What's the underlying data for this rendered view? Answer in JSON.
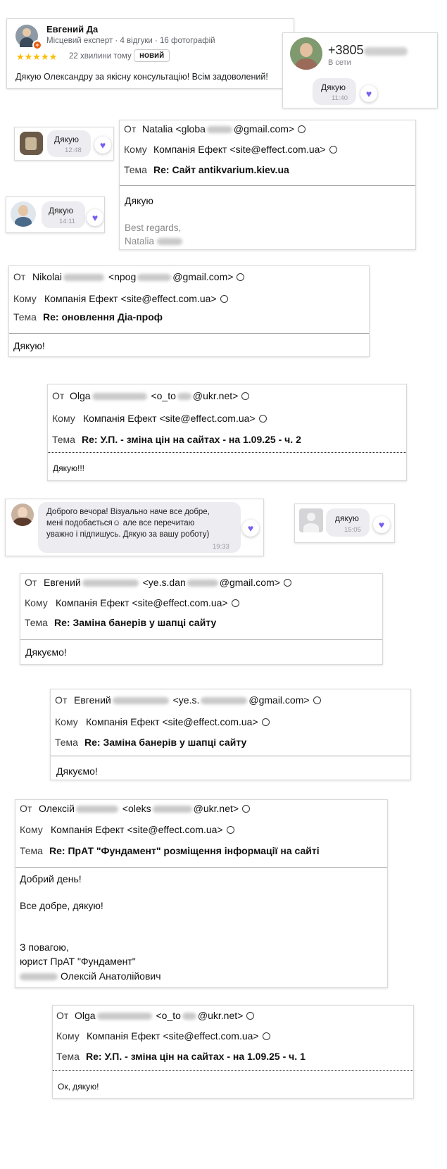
{
  "review": {
    "name": "Евгений Да",
    "meta": "Місцевий експерт · 4 відгуки · 16 фотографій",
    "stars": "★★★★★",
    "time": "22 хвилини тому",
    "badge": "новий",
    "text": "Дякую Олександру за якісну консультацію! Всім задоволений!",
    "star_color": "#fbbc04"
  },
  "viber_contact": {
    "phone": "+3805",
    "status": "В сети",
    "message": "Дякую",
    "time": "11:40"
  },
  "chats": [
    {
      "message": "Дякую",
      "time": "12:48"
    },
    {
      "message": "Дякую",
      "time": "14:11"
    },
    {
      "lines": [
        "Доброго вечора! Візуально наче все добре,",
        "мені подобається☺ але все перечитаю",
        "уважно і підпишусь. Дякую за вашу роботу)"
      ],
      "time": "19:33"
    },
    {
      "message": "дякую",
      "time": "15:05"
    }
  ],
  "accent_color": "#7360f2",
  "labels": {
    "from_ru": "От",
    "to_ua": "Кому",
    "subject_ru": "Тема"
  },
  "emails": [
    {
      "from_name": "Natalia",
      "from_email_start": "<globa",
      "from_email_end": "@gmail.com>",
      "to": "Компанія Ефект <site@effect.com.ua>",
      "subject": "Re: Сайт antikvarium.kiev.ua",
      "body": [
        "Дякую"
      ],
      "signature": [
        "Best regards,",
        "Natalia"
      ]
    },
    {
      "from_name": "Nikolai",
      "from_email_start": "<npog",
      "from_email_end": "@gmail.com>",
      "to": "Компанія Ефект <site@effect.com.ua>",
      "subject": "Re: оновлення Діа-проф",
      "body": [
        "Дякую!"
      ]
    },
    {
      "from_name": "Olga",
      "from_email_start": "<o_to",
      "from_email_end": "@ukr.net>",
      "to": "Компанія Ефект <site@effect.com.ua>",
      "subject": "Re: У.П. - зміна цін на сайтах - на 1.09.25 - ч. 2",
      "body": [
        "Дякую!!!"
      ]
    },
    {
      "from_name": "Евгений",
      "from_email_start": "<ye.s.dan",
      "from_email_end": "@gmail.com>",
      "to": "Компанія Ефект <site@effect.com.ua>",
      "subject": "Re: Заміна банерів у шапці сайту",
      "body": [
        "Дякуємо!"
      ]
    },
    {
      "from_name": "Евгений",
      "from_email_start": "<ye.s.",
      "from_email_end": "@gmail.com>",
      "to": "Компанія Ефект <site@effect.com.ua>",
      "subject": "Re: Заміна банерів у шапці сайту",
      "body": [
        "Дякуємо!"
      ]
    },
    {
      "from_name": "Олексій",
      "from_email_start": "<oleks",
      "from_email_end": "@ukr.net>",
      "to": "Компанія Ефект <site@effect.com.ua>",
      "subject": "Re: ПрАТ \"Фундамент\" розміщення інформації на сайті",
      "body": [
        "Добрий день!",
        "Все добре, дякую!",
        "З повагою,",
        "юрист ПрАТ \"Фундамент\"",
        "Олексій Анатолійович"
      ]
    },
    {
      "from_name": "Olga",
      "from_email_start": "<o_to",
      "from_email_end": "@ukr.net>",
      "to": "Компанія Ефект <site@effect.com.ua>",
      "subject": "Re: У.П. - зміна цін на сайтах - на 1.09.25 - ч. 1",
      "body": [
        "Ок, дякую!"
      ]
    }
  ]
}
